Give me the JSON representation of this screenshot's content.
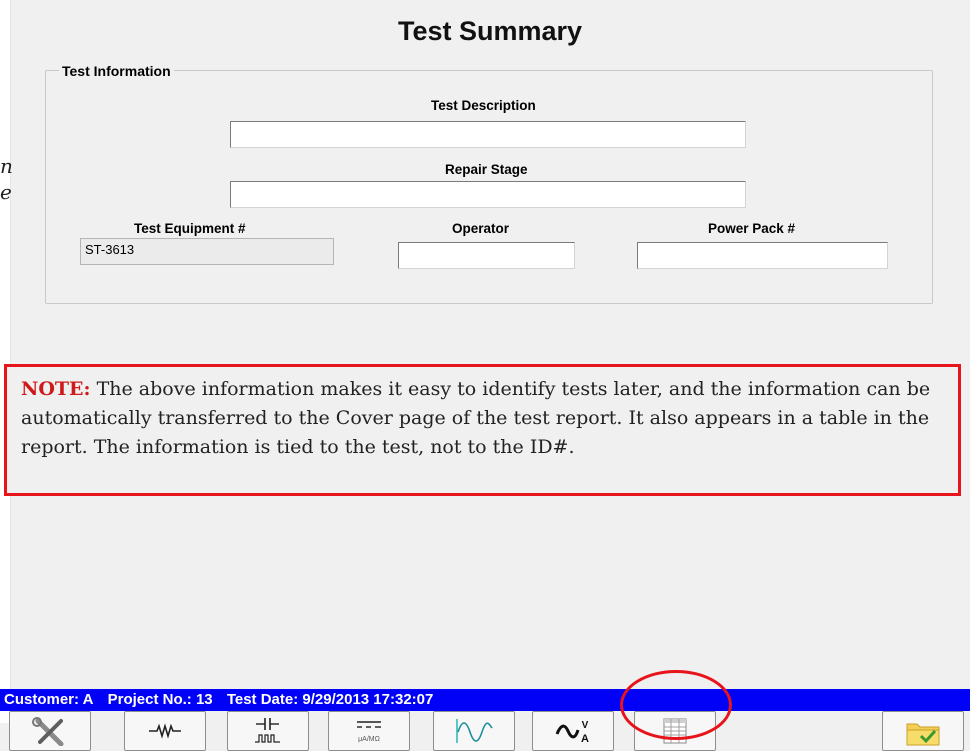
{
  "title": "Test Summary",
  "test_information": {
    "legend": "Test Information",
    "test_description": {
      "label": "Test Description",
      "value": ""
    },
    "repair_stage": {
      "label": "Repair Stage",
      "value": ""
    },
    "test_equipment": {
      "label": "Test Equipment #",
      "value": "ST-3613"
    },
    "operator": {
      "label": "Operator",
      "value": ""
    },
    "power_pack": {
      "label": "Power Pack #",
      "value": ""
    }
  },
  "note": {
    "prefix": "NOTE:",
    "text": "The above information makes it easy to identify tests later, and the information can be automatically transferred to the Cover page of the test report. It also appears in a table in the report. The information is tied to the test, not to the ID#."
  },
  "status_bar": {
    "customer": "Customer: A",
    "project": "Project No.: 13",
    "test_date": "Test Date: 9/29/2013 17:32:07"
  },
  "toolbar": {
    "buttons": [
      {
        "icon": "tools-icon"
      },
      {
        "icon": "resistor-icon"
      },
      {
        "icon": "capacitor-pulse-icon"
      },
      {
        "icon": "dc-amp-icon"
      },
      {
        "icon": "waveform-icon"
      },
      {
        "icon": "ac-volt-amp-icon"
      },
      {
        "icon": "table-icon"
      },
      {
        "icon": "folder-check-icon"
      }
    ]
  },
  "left_fragments": [
    "n",
    "e"
  ],
  "colors": {
    "accent_red": "#e8141c",
    "status_bar": "#0101f8"
  }
}
